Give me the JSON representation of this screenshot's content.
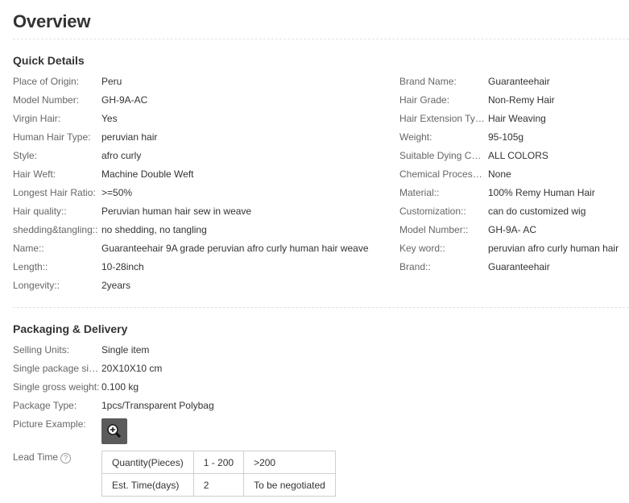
{
  "title": "Overview",
  "quick_details": {
    "heading": "Quick Details",
    "left": [
      {
        "label": "Place of Origin:",
        "value": "Peru"
      },
      {
        "label": "Model Number:",
        "value": "GH-9A-AC"
      },
      {
        "label": "Virgin Hair:",
        "value": "Yes"
      },
      {
        "label": "Human Hair Type:",
        "value": "peruvian hair"
      },
      {
        "label": "Style:",
        "value": "afro curly"
      },
      {
        "label": "Hair Weft:",
        "value": "Machine Double Weft"
      },
      {
        "label": "Longest Hair Ratio:",
        "value": ">=50%"
      },
      {
        "label": "Hair quality::",
        "value": "Peruvian human hair sew in weave"
      },
      {
        "label": "shedding&tangling::",
        "value": "no shedding, no tangling"
      },
      {
        "label": "Name::",
        "value": "Guaranteehair 9A grade peruvian afro curly human hair weave"
      },
      {
        "label": "Length::",
        "value": "10-28inch"
      },
      {
        "label": "Longevity::",
        "value": "2years"
      }
    ],
    "right": [
      {
        "label": "Brand Name:",
        "value": "Guaranteehair"
      },
      {
        "label": "Hair Grade:",
        "value": "Non-Remy Hair"
      },
      {
        "label": "Hair Extension Type:",
        "value": "Hair Weaving"
      },
      {
        "label": "Weight:",
        "value": "95-105g"
      },
      {
        "label": "Suitable Dying Colo...",
        "value": "ALL COLORS"
      },
      {
        "label": "Chemical Processi...",
        "value": "None"
      },
      {
        "label": "Material::",
        "value": "100% Remy Human Hair"
      },
      {
        "label": "Customization::",
        "value": "can do customized wig"
      },
      {
        "label": "Model Number::",
        "value": "GH-9A- AC"
      },
      {
        "label": "Key word::",
        "value": "peruvian afro curly human hair"
      },
      {
        "label": "Brand::",
        "value": "Guaranteehair"
      }
    ]
  },
  "packaging": {
    "heading": "Packaging & Delivery",
    "rows": [
      {
        "label": "Selling Units:",
        "value": "Single item"
      },
      {
        "label": "Single package size:",
        "value": "20X10X10 cm"
      },
      {
        "label": "Single gross weight:",
        "value": "0.100 kg"
      },
      {
        "label": "Package Type:",
        "value": "1pcs/Transparent Polybag"
      },
      {
        "label": "Picture Example:",
        "value": ""
      }
    ],
    "picture_icon": "zoom-in-icon",
    "lead_time": {
      "label": "Lead Time",
      "help_icon": "question-circle-icon",
      "help_glyph": "?",
      "rows": [
        [
          "Quantity(Pieces)",
          "1 - 200",
          ">200"
        ],
        [
          "Est. Time(days)",
          "2",
          "To be negotiated"
        ]
      ]
    }
  }
}
